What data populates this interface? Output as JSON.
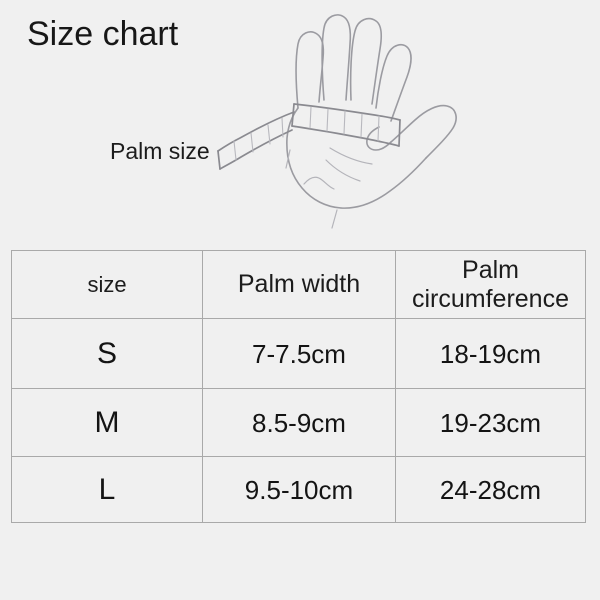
{
  "page": {
    "title": "Size chart",
    "background_color": "#f0f0f0",
    "text_color": "#1a1a1a"
  },
  "illustration": {
    "name": "hand-palm-measuring-tape",
    "callout_label": "Palm size",
    "description": "Line sketch of an open hand with a measuring tape wrapped across the palm",
    "stroke_color": "#9b9ba1",
    "tape_color": "#8a8a90"
  },
  "table": {
    "border_color": "#a9a9a9",
    "headers": {
      "size": "size",
      "palm_width": "Palm width",
      "palm_circumference": "Palm circumference"
    },
    "rows": [
      {
        "size": "S",
        "palm_width": "7-7.5cm",
        "palm_circumference": "18-19cm"
      },
      {
        "size": "M",
        "palm_width": "8.5-9cm",
        "palm_circumference": "19-23cm"
      },
      {
        "size": "L",
        "palm_width": "9.5-10cm",
        "palm_circumference": "24-28cm"
      }
    ]
  }
}
